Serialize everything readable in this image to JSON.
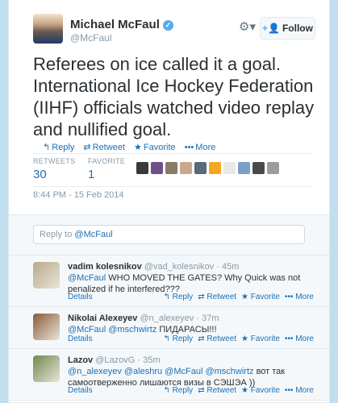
{
  "tweet": {
    "author_name": "Michael McFaul",
    "handle": "@McFaul",
    "follow_label": "Follow",
    "text": "Referees on ice called it a goal. International Ice Hockey Federation (IIHF) officials watched video replay and nullified goal.",
    "actions": {
      "reply": "Reply",
      "retweet": "Retweet",
      "favorite": "Favorite",
      "more": "More"
    },
    "retweets_label": "RETWEETS",
    "retweets": "30",
    "favorites_label": "FAVORITE",
    "favorites": "1",
    "timestamp": "8:44 PM - 15 Feb 2014",
    "favoriter_avatar_colors": [
      "#3a3a3a",
      "#6d4f8c",
      "#8a7b68",
      "#c9a98d",
      "#5a6a7a",
      "#f5a623",
      "#e8e8e8",
      "#7aa0c8",
      "#4a4a4a",
      "#9c9c9c"
    ]
  },
  "reply_box": {
    "prefix": "Reply to ",
    "mention": "@McFaul"
  },
  "replies": [
    {
      "name": "vadim kolesnikov",
      "handle": "@vad_kolesnikov",
      "time": "45m",
      "mention": "@McFaul",
      "text": " WHO MOVED THE GATES? Why Quick was not penalized if he interfered???",
      "details": "Details",
      "avatar_color": "#b9a98a"
    },
    {
      "name": "Nikolai Alexeyev",
      "handle": "@n_alexeyev",
      "time": "37m",
      "mention": "@McFaul @mschwirtz",
      "text": " ПИДАРАСЫ!!!",
      "details": "Details",
      "avatar_color": "#8a5a3a"
    },
    {
      "name": "Lazov",
      "handle": "@LazovG",
      "time": "35m",
      "mention": "@n_alexeyev @aleshru @McFaul @mschwirtz",
      "text": " вот так самоотверженно лишаются визы в СЭШЭА ))",
      "details": "Details",
      "avatar_color": "#6f8a4e"
    }
  ],
  "reply_actions": {
    "reply": "Reply",
    "retweet": "Retweet",
    "favorite": "Favorite",
    "more": "More"
  }
}
